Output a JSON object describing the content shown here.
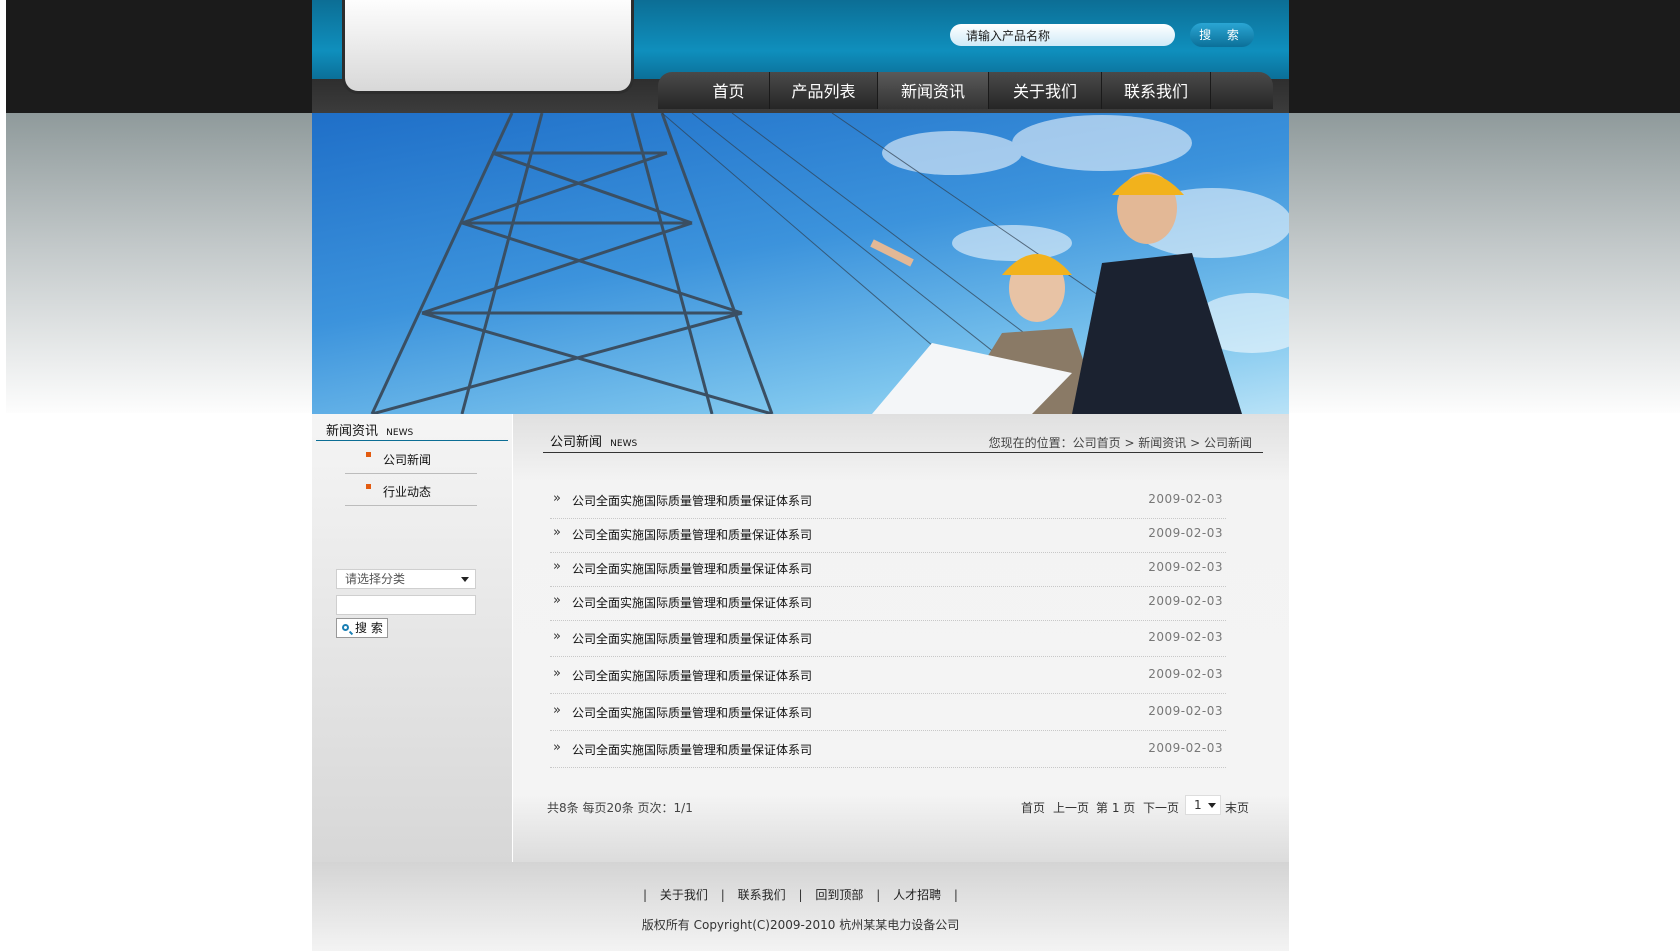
{
  "header": {
    "search_placeholder": "请输入产品名称",
    "search_button": "搜 索",
    "nav": [
      {
        "label": "首页"
      },
      {
        "label": "产品列表"
      },
      {
        "label": "新闻资讯"
      },
      {
        "label": "关于我们"
      },
      {
        "label": "联系我们"
      }
    ],
    "active_nav": "新闻资讯"
  },
  "sidebar": {
    "title": "新闻资讯",
    "title_en": "NEWS",
    "items": [
      {
        "label": "公司新闻"
      },
      {
        "label": "行业动态"
      }
    ],
    "category_select": "请选择分类",
    "search_button": "搜 索"
  },
  "main": {
    "title": "公司新闻",
    "title_en": "NEWS",
    "breadcrumb": "您现在的位置：公司首页 > 新闻资讯 > 公司新闻",
    "news": [
      {
        "title": "公司全面实施国际质量管理和质量保证体系司",
        "date": "2009-02-03"
      },
      {
        "title": "公司全面实施国际质量管理和质量保证体系司",
        "date": "2009-02-03"
      },
      {
        "title": "公司全面实施国际质量管理和质量保证体系司",
        "date": "2009-02-03"
      },
      {
        "title": "公司全面实施国际质量管理和质量保证体系司",
        "date": "2009-02-03"
      },
      {
        "title": "公司全面实施国际质量管理和质量保证体系司",
        "date": "2009-02-03"
      },
      {
        "title": "公司全面实施国际质量管理和质量保证体系司",
        "date": "2009-02-03"
      },
      {
        "title": "公司全面实施国际质量管理和质量保证体系司",
        "date": "2009-02-03"
      },
      {
        "title": "公司全面实施国际质量管理和质量保证体系司",
        "date": "2009-02-03"
      }
    ],
    "pager_info": "共8条 每页20条 页次：1/1",
    "pager": {
      "first": "首页",
      "prev": "上一页",
      "current": "第 1 页",
      "next": "下一页",
      "page_select": "1",
      "last": "末页"
    }
  },
  "footer": {
    "links": [
      {
        "label": "关于我们"
      },
      {
        "label": "联系我们"
      },
      {
        "label": "回到顶部"
      },
      {
        "label": "人才招聘"
      }
    ],
    "separator": "|",
    "copyright": "版权所有 Copyright(C)2009-2010 杭州某某电力设备公司"
  },
  "colors": {
    "header_blue": "#0f8fbd",
    "nav_dark": "#2e2e2e",
    "bullet_orange": "#e35b10"
  }
}
